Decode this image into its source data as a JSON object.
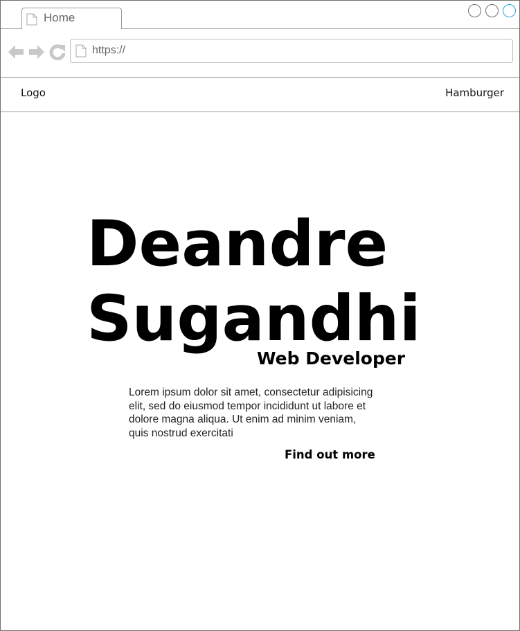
{
  "browser": {
    "tab_label": "Home",
    "url": "https://",
    "icons": {
      "back": "back-arrow-icon",
      "forward": "forward-arrow-icon",
      "reload": "reload-icon",
      "page": "page-icon"
    },
    "window_buttons": [
      "minimize",
      "maximize",
      "close"
    ],
    "colors": {
      "chrome_gray": "#c8c8c8",
      "close_accent": "#29a3e0"
    }
  },
  "site_nav": {
    "logo": "Logo",
    "menu": "Hamburger"
  },
  "hero": {
    "name_line1": "Deandre",
    "name_line2": "Sugandhi",
    "role": "Web Developer",
    "description": "Lorem ipsum dolor sit amet, consectetur adipisicing elit, sed do eiusmod tempor incididunt ut labore et dolore magna aliqua. Ut enim ad minim veniam, quis nostrud exercitati",
    "cta": "Find out more"
  }
}
